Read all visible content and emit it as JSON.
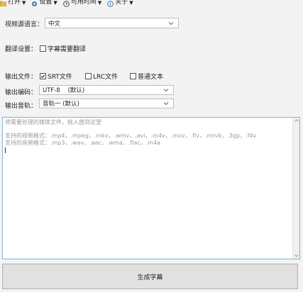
{
  "menubar": {
    "items": [
      {
        "label": "打开",
        "icon": "folder-icon"
      },
      {
        "label": "设置",
        "icon": "gear-icon"
      },
      {
        "label": "可用时间",
        "icon": "clock-icon"
      },
      {
        "label": "关于",
        "icon": "info-icon"
      }
    ]
  },
  "source_language": {
    "label": "视频源语言：",
    "value": "中文"
  },
  "translation": {
    "label": "翻译设置：",
    "checkbox_label": "字幕需要翻译",
    "checked": false
  },
  "output_file": {
    "label": "输出文件：",
    "options": [
      {
        "label": "SRT文件",
        "checked": true
      },
      {
        "label": "LRC文件",
        "checked": false
      },
      {
        "label": "普通文本",
        "checked": false
      }
    ]
  },
  "output_encoding": {
    "label": "输出编码：",
    "value": "UTF-8    (默认)"
  },
  "output_track": {
    "label": "输出音轨：",
    "value": "音轨一 (默认)"
  },
  "dropzone": {
    "hint": "将需要处理的媒体文件，拖入放到这里",
    "video_formats": "支持的视频格式：.mp4，.mpeg，.mkv，.wmv，.avi，.m4v，.mov，.flv，.rmvb，.3gp，.f4v",
    "audio_formats": "支持的音频格式：.mp3，.wav，.aac，.wma，.flac，.m4a"
  },
  "generate_button": {
    "label": "生成字幕"
  },
  "colors": {
    "accent_border": "#7fb3d5",
    "menu_icon_blue": "#2a6fb0"
  }
}
